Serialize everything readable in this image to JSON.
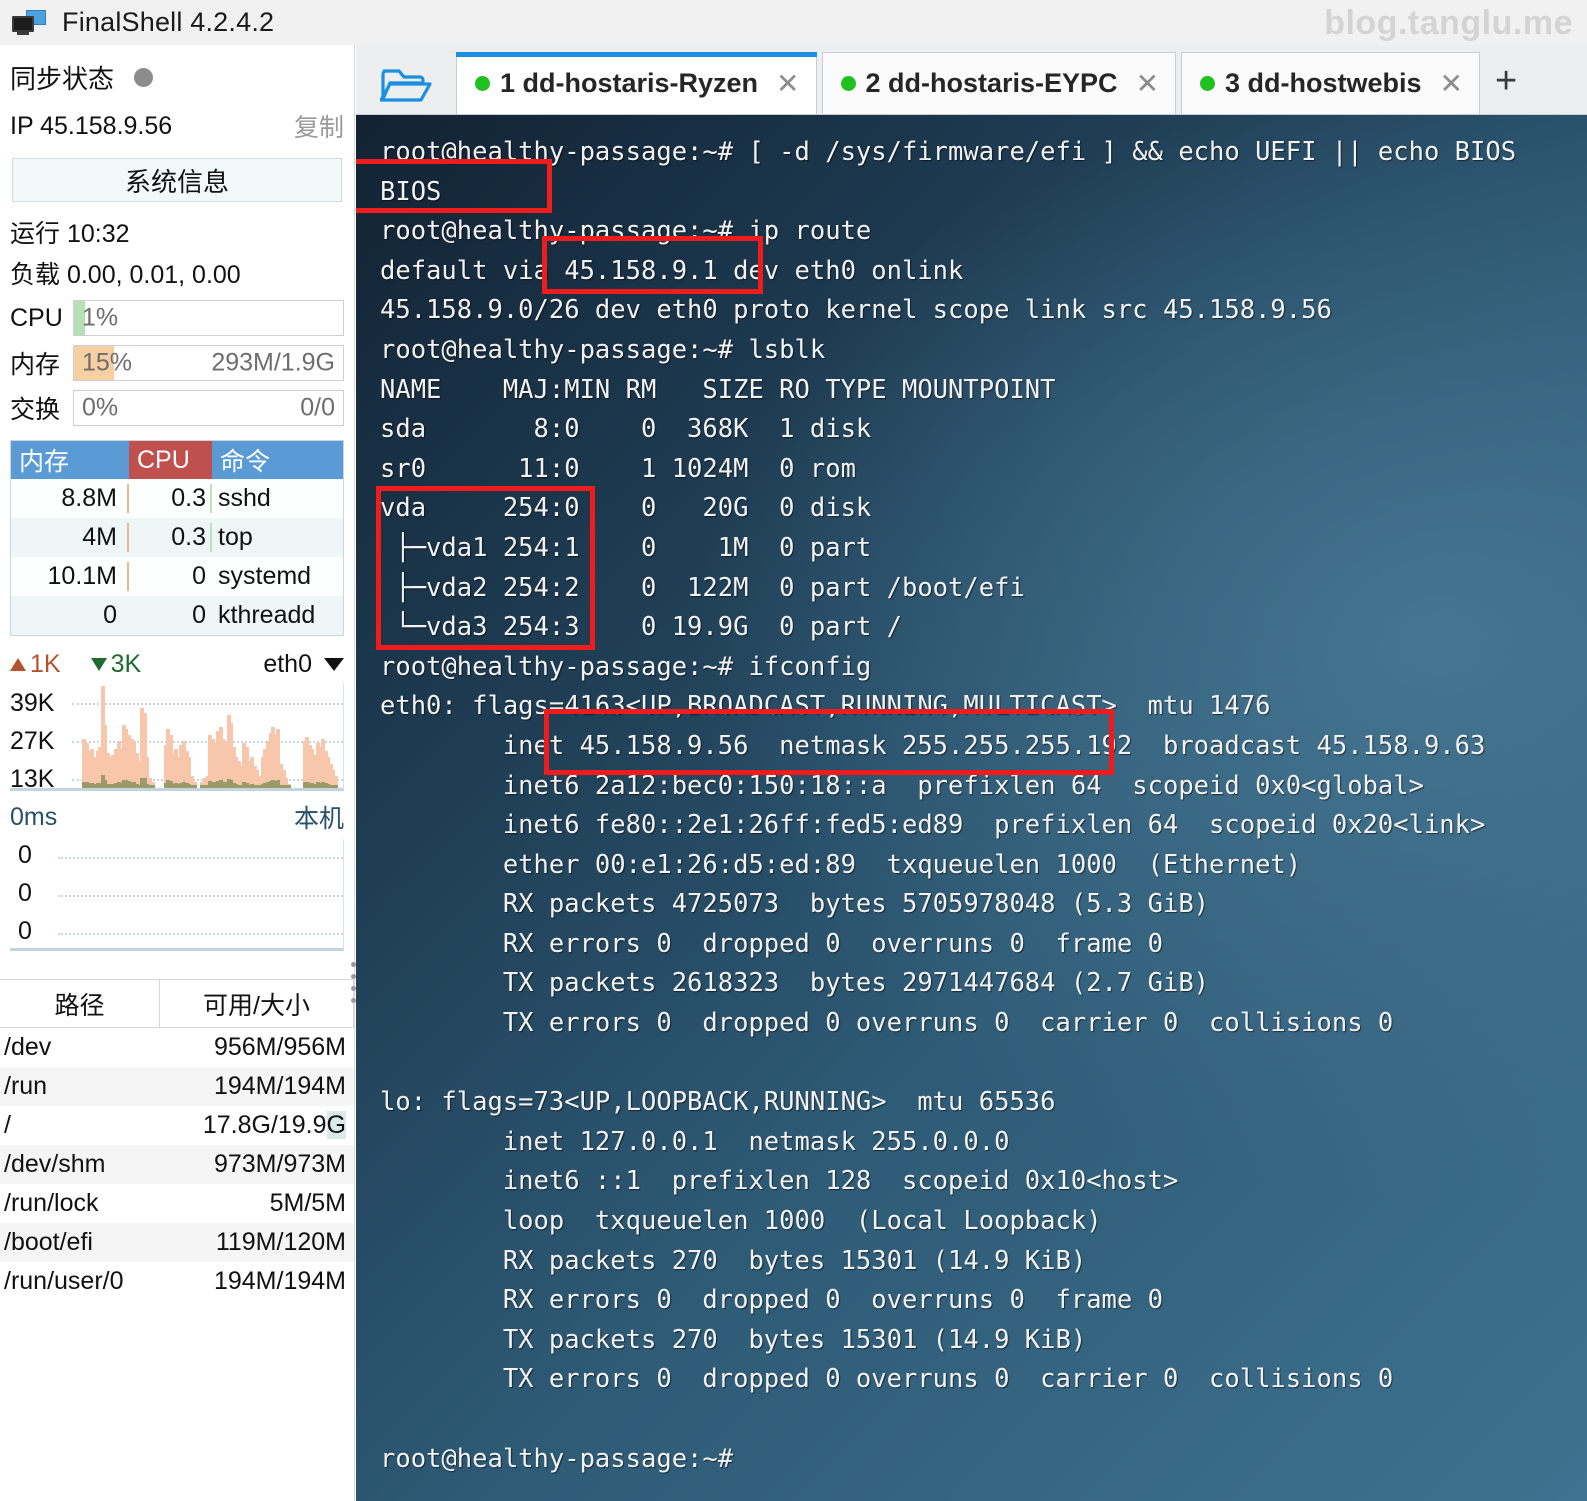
{
  "window": {
    "title": "FinalShell 4.2.4.2",
    "app_icon": "monitor-icon",
    "watermark": "blog.tanglu.me"
  },
  "sidebar": {
    "sync_label": "同步状态",
    "sync_status_icon": "status-dot",
    "ip_label": "IP  45.158.9.56",
    "copy_label": "复制",
    "system_info_button": "系统信息",
    "uptime": "运行 10:32",
    "load": "负载 0.00, 0.01, 0.00",
    "meters": [
      {
        "name": "cpu",
        "label": "CPU",
        "percent": "1%",
        "detail": "",
        "fill_pct": 1,
        "color": "#b6e0b6"
      },
      {
        "name": "mem",
        "label": "内存",
        "percent": "15%",
        "detail": "293M/1.9G",
        "fill_pct": 15,
        "color": "#f6cfa3"
      },
      {
        "name": "swap",
        "label": "交换",
        "percent": "0%",
        "detail": "0/0",
        "fill_pct": 0,
        "color": "#cfe3f5"
      }
    ],
    "process_table": {
      "headers": [
        "内存",
        "CPU",
        "命令"
      ],
      "rows": [
        {
          "mem": "8.8M",
          "cpu": "0.3",
          "cmd": "sshd"
        },
        {
          "mem": "4M",
          "cpu": "0.3",
          "cmd": "top"
        },
        {
          "mem": "10.1M",
          "cpu": "0",
          "cmd": "systemd"
        },
        {
          "mem": "0",
          "cpu": "0",
          "cmd": "kthreadd"
        }
      ]
    },
    "network": {
      "upload": "1K",
      "download": "3K",
      "interface": "eth0",
      "interface_caret": "chevron-down-icon",
      "y_labels": [
        "39K",
        "27K",
        "13K"
      ]
    },
    "ping": {
      "latency": "0ms",
      "host_label": "本机",
      "y_labels": [
        "0",
        "0",
        "0"
      ]
    },
    "disk_table": {
      "headers": [
        "路径",
        "可用/大小"
      ],
      "rows": [
        {
          "path": "/dev",
          "value": "956M/956M"
        },
        {
          "path": "/run",
          "value": "194M/194M"
        },
        {
          "path": "/",
          "value": "17.8G/19.9G"
        },
        {
          "path": "/dev/shm",
          "value": "973M/973M"
        },
        {
          "path": "/run/lock",
          "value": "5M/5M"
        },
        {
          "path": "/boot/efi",
          "value": "119M/120M"
        },
        {
          "path": "/run/user/0",
          "value": "194M/194M"
        }
      ]
    }
  },
  "tabbar": {
    "folder_icon": "folder-open-icon",
    "add_tab_label": "+",
    "close_label": "✕",
    "tabs": [
      {
        "label": "1 dd-hostaris-Ryzen",
        "active": true,
        "status": "connected"
      },
      {
        "label": "2 dd-hostaris-EYPC",
        "active": false,
        "status": "connected"
      },
      {
        "label": "3 dd-hostwebis",
        "active": false,
        "status": "connected"
      }
    ]
  },
  "terminal": {
    "prompt": "root@healthy-passage:~#",
    "lines": [
      "root@healthy-passage:~# [ -d /sys/firmware/efi ] && echo UEFI || echo BIOS",
      "BIOS",
      "root@healthy-passage:~# ip route",
      "default via 45.158.9.1 dev eth0 onlink",
      "45.158.9.0/26 dev eth0 proto kernel scope link src 45.158.9.56",
      "root@healthy-passage:~# lsblk",
      "NAME    MAJ:MIN RM   SIZE RO TYPE MOUNTPOINT",
      "sda       8:0    0  368K  1 disk",
      "sr0      11:0    1 1024M  0 rom",
      "vda     254:0    0   20G  0 disk",
      " ├─vda1 254:1    0    1M  0 part",
      " ├─vda2 254:2    0  122M  0 part /boot/efi",
      " └─vda3 254:3    0 19.9G  0 part /",
      "root@healthy-passage:~# ifconfig",
      "eth0: flags=4163<UP,BROADCAST,RUNNING,MULTICAST>  mtu 1476",
      "        inet 45.158.9.56  netmask 255.255.255.192  broadcast 45.158.9.63",
      "        inet6 2a12:bec0:150:18::a  prefixlen 64  scopeid 0x0<global>",
      "        inet6 fe80::2e1:26ff:fed5:ed89  prefixlen 64  scopeid 0x20<link>",
      "        ether 00:e1:26:d5:ed:89  txqueuelen 1000  (Ethernet)",
      "        RX packets 4725073  bytes 5705978048 (5.3 GiB)",
      "        RX errors 0  dropped 0  overruns 0  frame 0",
      "        TX packets 2618323  bytes 2971447684 (2.7 GiB)",
      "        TX errors 0  dropped 0 overruns 0  carrier 0  collisions 0",
      "",
      "lo: flags=73<UP,LOOPBACK,RUNNING>  mtu 65536",
      "        inet 127.0.0.1  netmask 255.0.0.0",
      "        inet6 ::1  prefixlen 128  scopeid 0x10<host>",
      "        loop  txqueuelen 1000  (Local Loopback)",
      "        RX packets 270  bytes 15301 (14.9 KiB)",
      "        RX errors 0  dropped 0  overruns 0  frame 0",
      "        TX packets 270  bytes 15301 (14.9 KiB)",
      "        TX errors 0  dropped 0 overruns 0  carrier 0  collisions 0",
      "",
      "root@healthy-passage:~#"
    ],
    "annotations": [
      {
        "name": "bios-highlight",
        "color": "#ee1c1c"
      },
      {
        "name": "gateway-highlight",
        "color": "#ee1c1c"
      },
      {
        "name": "vda-partitions-highlight",
        "color": "#ee1c1c"
      },
      {
        "name": "inet-netmask-highlight",
        "color": "#ee1c1c"
      }
    ]
  }
}
